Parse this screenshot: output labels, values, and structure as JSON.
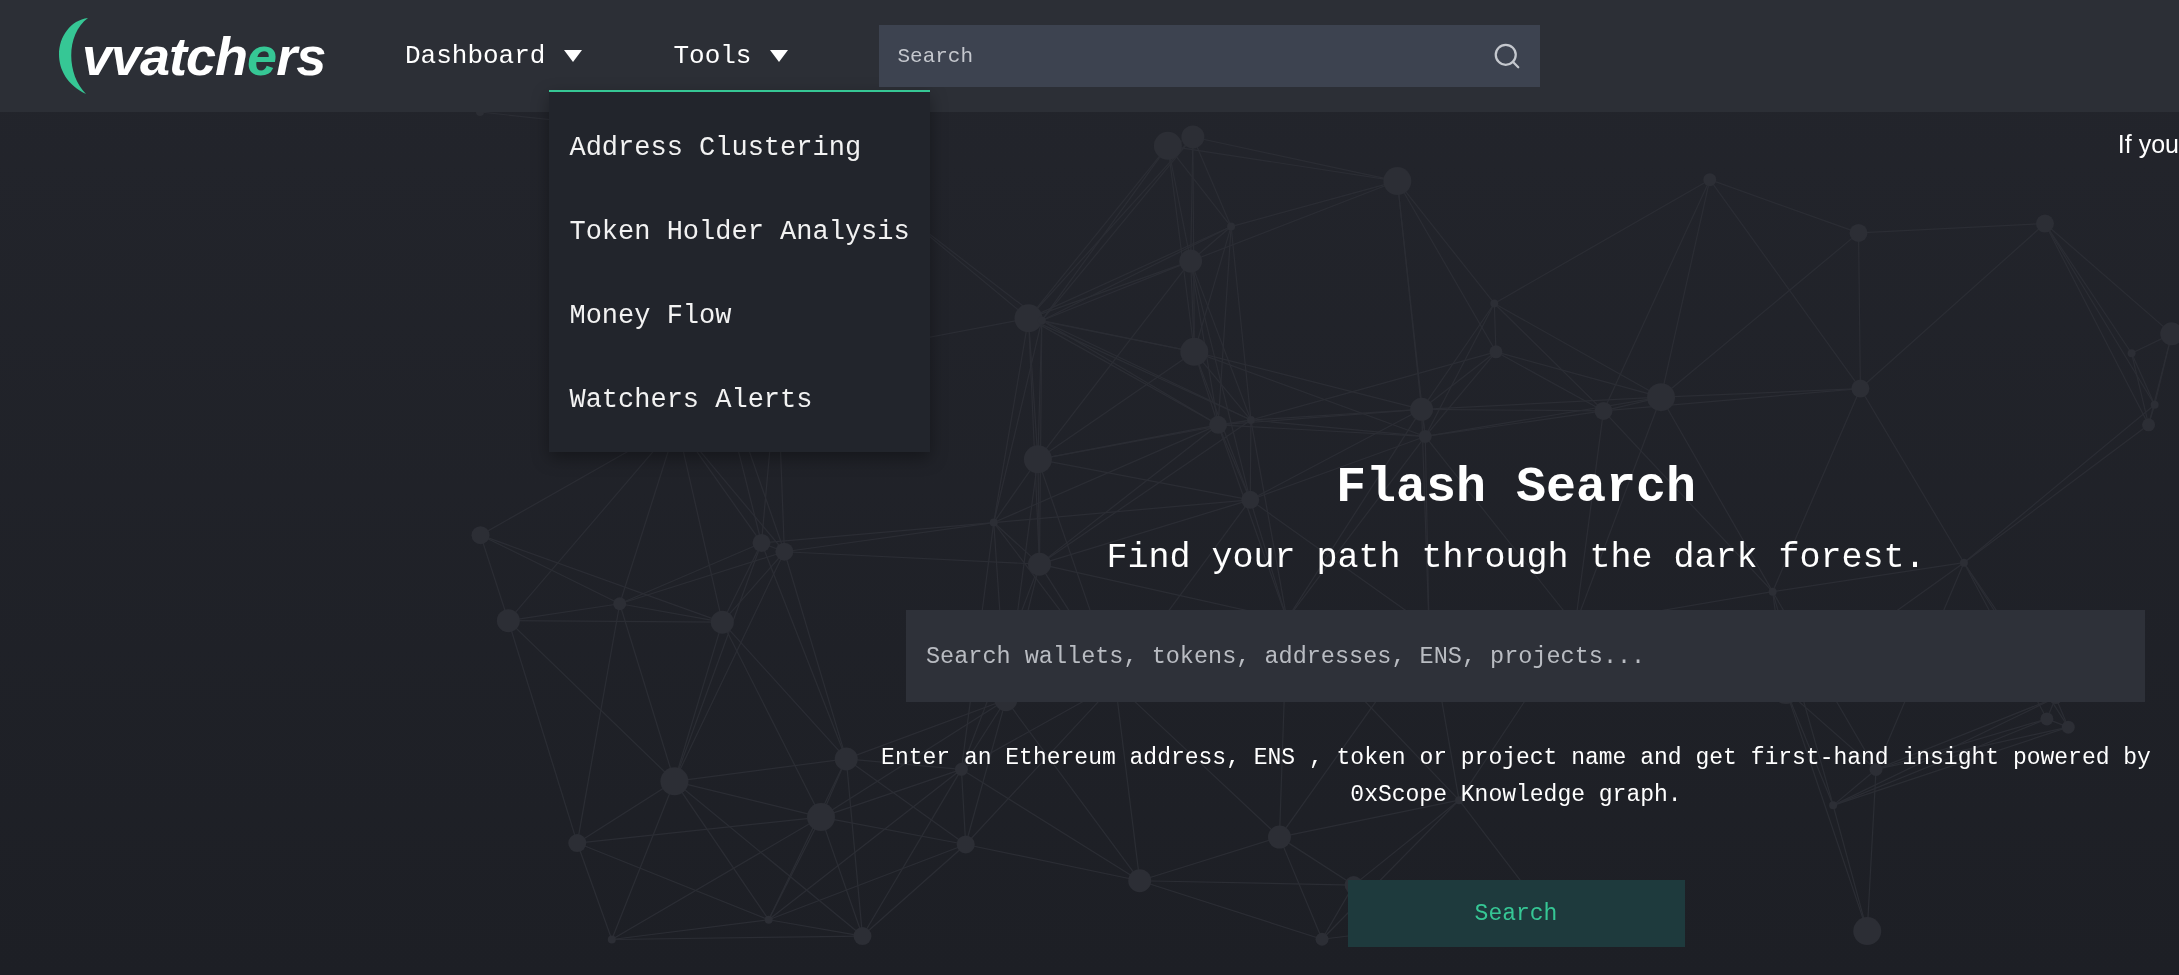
{
  "header": {
    "logo": {
      "parts": [
        {
          "text": "vvatch",
          "accent": false
        },
        {
          "text": "e",
          "accent": true
        },
        {
          "text": "rs",
          "accent": false
        }
      ]
    },
    "nav": [
      {
        "label": "Dashboard"
      },
      {
        "label": "Tools",
        "menu": [
          "Address Clustering",
          "Token Holder Analysis",
          "Money Flow",
          "Watchers Alerts"
        ]
      }
    ],
    "search": {
      "placeholder": "Search"
    }
  },
  "notice": "If you",
  "hero": {
    "title": "Flash Search",
    "subtitle": "Find your path through the dark forest.",
    "search": {
      "placeholder": "Search wallets, tokens, addresses, ENS, projects..."
    },
    "description": "Enter an Ethereum address, ENS , token or project name and get first-hand insight powered by 0xScope Knowledge graph.",
    "button": "Search"
  }
}
